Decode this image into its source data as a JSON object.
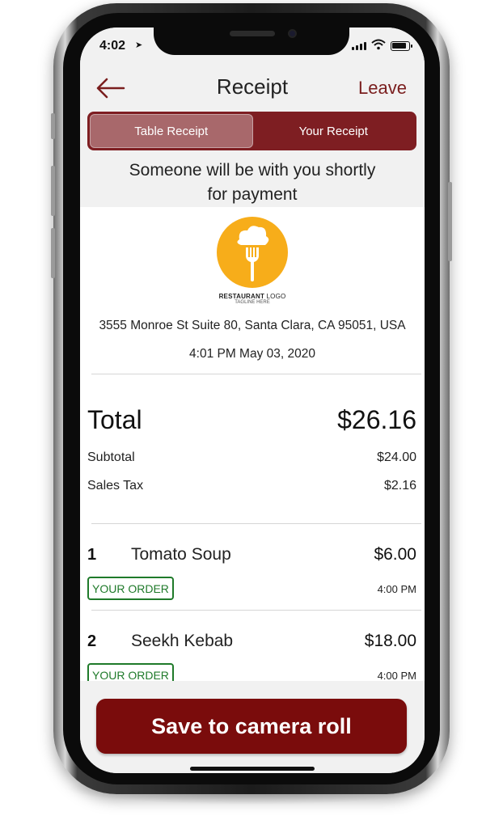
{
  "status_bar": {
    "time": "4:02"
  },
  "header": {
    "title": "Receipt",
    "leave_label": "Leave"
  },
  "tabs": [
    {
      "label": "Table Receipt",
      "active": true
    },
    {
      "label": "Your Receipt",
      "active": false
    }
  ],
  "notice": {
    "line1": "Someone will be with you shortly",
    "line2": "for payment"
  },
  "restaurant": {
    "logo_name_bold": "RESTAURANT",
    "logo_name_light": "LOGO",
    "logo_tagline": "TAGLINE HERE",
    "address": "3555 Monroe St Suite 80, Santa Clara, CA 95051, USA",
    "datetime": "4:01 PM May 03, 2020"
  },
  "summary": {
    "total_label": "Total",
    "total_value": "$26.16",
    "subtotal_label": "Subtotal",
    "subtotal_value": "$24.00",
    "tax_label": "Sales Tax",
    "tax_value": "$2.16"
  },
  "items": [
    {
      "qty": "1",
      "name": "Tomato Soup",
      "price": "$6.00",
      "badge": "YOUR ORDER",
      "time": "4:00 PM"
    },
    {
      "qty": "2",
      "name": "Seekh Kebab",
      "price": "$18.00",
      "badge": "YOUR ORDER",
      "time": "4:00 PM"
    }
  ],
  "footer": {
    "save_label": "Save to camera roll"
  },
  "colors": {
    "brand": "#7a0c0c",
    "segment_bg": "#7e1e22",
    "badge_green": "#1f7a2a",
    "logo_yellow": "#f7ad1a"
  },
  "icons": [
    "back-arrow-icon",
    "location-arrow-icon",
    "signal-icon",
    "wifi-icon",
    "battery-icon",
    "chef-fork-icon"
  ]
}
